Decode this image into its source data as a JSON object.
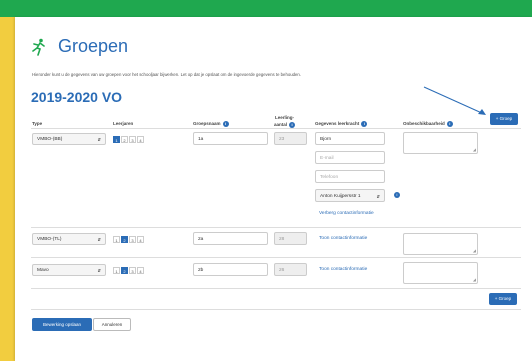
{
  "page": {
    "title": "Groepen",
    "intro": "Hieronder kunt u de gegevens van uw groepen voor het schooljaar bijwerken. Let op dat je opslaat om de ingevoerde gegevens te behouden.",
    "school_year": "2019-2020 VO"
  },
  "table": {
    "headers": {
      "type": "Type",
      "leerjaren": "Leerjaren",
      "groepsnaam": "Groepsnaam",
      "leerling_line1": "Leerling-",
      "leerling_line2": "aantal",
      "leerkracht": "Gegevens leerkracht",
      "onbeschikbaarheid": "Onbeschikbaarheid"
    },
    "add_group_label": "+ Groep",
    "year_options": [
      "1",
      "2",
      "3",
      "4"
    ],
    "rows": [
      {
        "type": "VMBO-(BB)",
        "selected_year": "1",
        "groepsnaam": "1a",
        "leerling_aantal": "23",
        "teacher_name": "Bjorn",
        "email_placeholder": "E-mail",
        "phone_placeholder": "Telefoon",
        "address": "Anton Kuijpersstr 1",
        "contact_link": "Verberg contactinformatie"
      },
      {
        "type": "VMBO-(TL)",
        "selected_year": "2",
        "groepsnaam": "2a",
        "leerling_aantal": "28",
        "contact_link": "Toon contactinformatie"
      },
      {
        "type": "Mavo",
        "selected_year": "2",
        "groepsnaam": "2b",
        "leerling_aantal": "26",
        "contact_link": "Toon contactinformatie"
      }
    ]
  },
  "footer": {
    "save_label": "Bewerking opslaan",
    "cancel_label": "Annuleren"
  },
  "colors": {
    "green_bar": "#1fa84f",
    "yellow_frame": "#f2cd3f",
    "accent_blue": "#2b6cb6"
  },
  "icons": {
    "logo": "running-figure-logo-icon",
    "info": "info-icon",
    "dropdown": "chevron-updown-icon",
    "resize": "resize-grip-icon",
    "annotation": "arrow-annotation-icon"
  }
}
